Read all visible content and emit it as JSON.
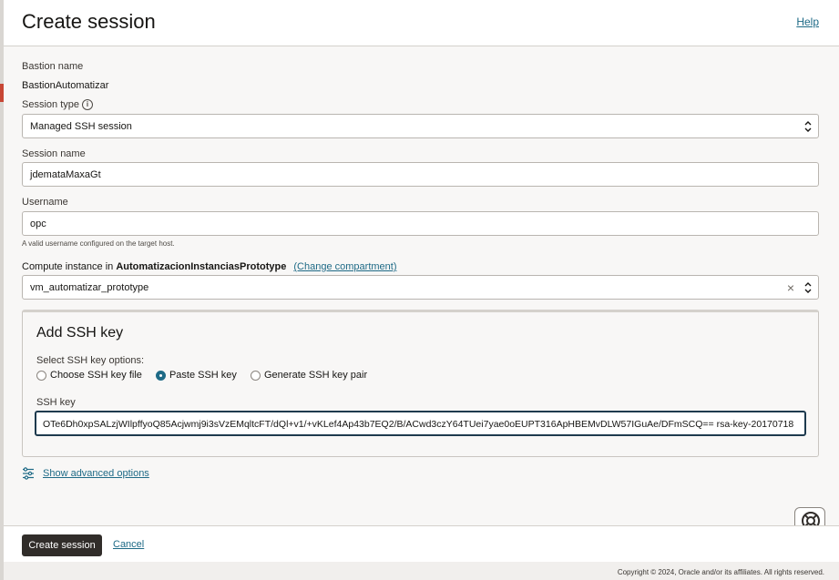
{
  "header": {
    "title": "Create session",
    "help": "Help"
  },
  "form": {
    "bastion_label": "Bastion name",
    "bastion_value": "BastionAutomatizar",
    "session_type_label": "Session type",
    "session_type_info": "i",
    "session_type_value": "Managed SSH session",
    "session_name_label": "Session name",
    "session_name_value": "jdemataMaxaGt",
    "username_label": "Username",
    "username_value": "opc",
    "username_hint": "A valid username configured on the target host.",
    "compute_prefix": "Compute instance in ",
    "compute_compartment": "AutomatizacionInstanciasPrototype",
    "change_compartment": "(Change compartment)",
    "compute_value": "vm_automatizar_prototype",
    "clear_glyph": "×"
  },
  "ssh": {
    "heading": "Add SSH key",
    "options_label": "Select SSH key options:",
    "options": [
      {
        "label": "Choose SSH key file",
        "selected": false
      },
      {
        "label": "Paste SSH key",
        "selected": true
      },
      {
        "label": "Generate SSH key pair",
        "selected": false
      }
    ],
    "key_label": "SSH key",
    "key_value": "OTe6Dh0xpSALzjWIlpffyoQ85Acjwmj9i3sVzEMqltcFT/dQl+v1/+vKLef4Ap43b7EQ2/B/ACwd3czY64TUei7yae0oEUPT316ApHBEMvDLW57IGuAe/DFmSCQ== rsa-key-20170718"
  },
  "advanced": {
    "label": "Show advanced options",
    "icon": "sliders-icon"
  },
  "footer": {
    "primary": "Create session",
    "cancel": "Cancel"
  },
  "copyright": "Copyright © 2024, Oracle and/or its affiliates. All rights reserved.",
  "colors": {
    "link": "#1e6a86",
    "primary_button": "#312d2a",
    "accent_red": "#c74634"
  }
}
